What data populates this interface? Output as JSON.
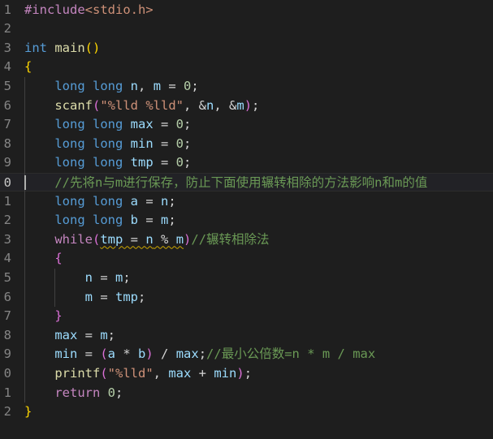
{
  "colors": {
    "background": "#1e1e1e",
    "keyword": "#569cd6",
    "control": "#c586c0",
    "function": "#dcdcaa",
    "variable": "#9cdcfe",
    "string": "#ce9178",
    "number": "#b5cea8",
    "comment": "#6a9955",
    "plain": "#d4d4d4",
    "bracket_gold": "#ffd700",
    "bracket_purple": "#da70d6",
    "line_number": "#858585",
    "warning_squiggle": "#cca700"
  },
  "editor": {
    "active_line": 9,
    "lines": [
      {
        "num": "1",
        "tokens": [
          {
            "t": "#include",
            "c": "control"
          },
          {
            "t": "<stdio.h>",
            "c": "string"
          }
        ]
      },
      {
        "num": "2",
        "tokens": []
      },
      {
        "num": "3",
        "tokens": [
          {
            "t": "int",
            "c": "keyword"
          },
          {
            "t": " ",
            "c": "plain"
          },
          {
            "t": "main",
            "c": "function"
          },
          {
            "t": "()",
            "c": "bracket_gold"
          }
        ]
      },
      {
        "num": "4",
        "tokens": [
          {
            "t": "{",
            "c": "bracket_gold"
          }
        ]
      },
      {
        "num": "5",
        "tokens": [
          {
            "t": "    ",
            "c": "plain"
          },
          {
            "t": "long",
            "c": "keyword"
          },
          {
            "t": " ",
            "c": "plain"
          },
          {
            "t": "long",
            "c": "keyword"
          },
          {
            "t": " ",
            "c": "plain"
          },
          {
            "t": "n",
            "c": "variable"
          },
          {
            "t": ", ",
            "c": "plain"
          },
          {
            "t": "m",
            "c": "variable"
          },
          {
            "t": " = ",
            "c": "plain"
          },
          {
            "t": "0",
            "c": "number"
          },
          {
            "t": ";",
            "c": "plain"
          }
        ]
      },
      {
        "num": "6",
        "tokens": [
          {
            "t": "    ",
            "c": "plain"
          },
          {
            "t": "scanf",
            "c": "function"
          },
          {
            "t": "(",
            "c": "bracket_purple"
          },
          {
            "t": "\"%lld %lld\"",
            "c": "string"
          },
          {
            "t": ", &",
            "c": "plain"
          },
          {
            "t": "n",
            "c": "variable"
          },
          {
            "t": ", &",
            "c": "plain"
          },
          {
            "t": "m",
            "c": "variable"
          },
          {
            "t": ")",
            "c": "bracket_purple"
          },
          {
            "t": ";",
            "c": "plain"
          }
        ]
      },
      {
        "num": "7",
        "tokens": [
          {
            "t": "    ",
            "c": "plain"
          },
          {
            "t": "long",
            "c": "keyword"
          },
          {
            "t": " ",
            "c": "plain"
          },
          {
            "t": "long",
            "c": "keyword"
          },
          {
            "t": " ",
            "c": "plain"
          },
          {
            "t": "max",
            "c": "variable"
          },
          {
            "t": " = ",
            "c": "plain"
          },
          {
            "t": "0",
            "c": "number"
          },
          {
            "t": ";",
            "c": "plain"
          }
        ]
      },
      {
        "num": "8",
        "tokens": [
          {
            "t": "    ",
            "c": "plain"
          },
          {
            "t": "long",
            "c": "keyword"
          },
          {
            "t": " ",
            "c": "plain"
          },
          {
            "t": "long",
            "c": "keyword"
          },
          {
            "t": " ",
            "c": "plain"
          },
          {
            "t": "min",
            "c": "variable"
          },
          {
            "t": " = ",
            "c": "plain"
          },
          {
            "t": "0",
            "c": "number"
          },
          {
            "t": ";",
            "c": "plain"
          }
        ]
      },
      {
        "num": "9",
        "tokens": [
          {
            "t": "    ",
            "c": "plain"
          },
          {
            "t": "long",
            "c": "keyword"
          },
          {
            "t": " ",
            "c": "plain"
          },
          {
            "t": "long",
            "c": "keyword"
          },
          {
            "t": " ",
            "c": "plain"
          },
          {
            "t": "tmp",
            "c": "variable"
          },
          {
            "t": " = ",
            "c": "plain"
          },
          {
            "t": "0",
            "c": "number"
          },
          {
            "t": ";",
            "c": "plain"
          }
        ]
      },
      {
        "num": "0",
        "tokens": [
          {
            "t": "    ",
            "c": "plain"
          },
          {
            "t": "//先将n与m进行保存，防止下面使用辗转相除的方法影响n和m的值",
            "c": "comment"
          }
        ]
      },
      {
        "num": "1",
        "tokens": [
          {
            "t": "    ",
            "c": "plain"
          },
          {
            "t": "long",
            "c": "keyword"
          },
          {
            "t": " ",
            "c": "plain"
          },
          {
            "t": "long",
            "c": "keyword"
          },
          {
            "t": " ",
            "c": "plain"
          },
          {
            "t": "a",
            "c": "variable"
          },
          {
            "t": " = ",
            "c": "plain"
          },
          {
            "t": "n",
            "c": "variable"
          },
          {
            "t": ";",
            "c": "plain"
          }
        ]
      },
      {
        "num": "2",
        "tokens": [
          {
            "t": "    ",
            "c": "plain"
          },
          {
            "t": "long",
            "c": "keyword"
          },
          {
            "t": " ",
            "c": "plain"
          },
          {
            "t": "long",
            "c": "keyword"
          },
          {
            "t": " ",
            "c": "plain"
          },
          {
            "t": "b",
            "c": "variable"
          },
          {
            "t": " = ",
            "c": "plain"
          },
          {
            "t": "m",
            "c": "variable"
          },
          {
            "t": ";",
            "c": "plain"
          }
        ]
      },
      {
        "num": "3",
        "tokens": [
          {
            "t": "    ",
            "c": "plain"
          },
          {
            "t": "while",
            "c": "control"
          },
          {
            "t": "(",
            "c": "bracket_purple"
          },
          {
            "t": "tmp",
            "c": "variable",
            "sq": true
          },
          {
            "t": " = ",
            "c": "plain",
            "sq": true
          },
          {
            "t": "n",
            "c": "variable",
            "sq": true
          },
          {
            "t": " % ",
            "c": "plain",
            "sq": true
          },
          {
            "t": "m",
            "c": "variable",
            "sq": true
          },
          {
            "t": ")",
            "c": "bracket_purple"
          },
          {
            "t": "//辗转相除法",
            "c": "comment"
          }
        ]
      },
      {
        "num": "4",
        "tokens": [
          {
            "t": "    ",
            "c": "plain"
          },
          {
            "t": "{",
            "c": "bracket_purple"
          }
        ]
      },
      {
        "num": "5",
        "tokens": [
          {
            "t": "        ",
            "c": "plain"
          },
          {
            "t": "n",
            "c": "variable"
          },
          {
            "t": " = ",
            "c": "plain"
          },
          {
            "t": "m",
            "c": "variable"
          },
          {
            "t": ";",
            "c": "plain"
          }
        ]
      },
      {
        "num": "6",
        "tokens": [
          {
            "t": "        ",
            "c": "plain"
          },
          {
            "t": "m",
            "c": "variable"
          },
          {
            "t": " = ",
            "c": "plain"
          },
          {
            "t": "tmp",
            "c": "variable"
          },
          {
            "t": ";",
            "c": "plain"
          }
        ]
      },
      {
        "num": "7",
        "tokens": [
          {
            "t": "    ",
            "c": "plain"
          },
          {
            "t": "}",
            "c": "bracket_purple"
          }
        ]
      },
      {
        "num": "8",
        "tokens": [
          {
            "t": "    ",
            "c": "plain"
          },
          {
            "t": "max",
            "c": "variable"
          },
          {
            "t": " = ",
            "c": "plain"
          },
          {
            "t": "m",
            "c": "variable"
          },
          {
            "t": ";",
            "c": "plain"
          }
        ]
      },
      {
        "num": "9",
        "tokens": [
          {
            "t": "    ",
            "c": "plain"
          },
          {
            "t": "min",
            "c": "variable"
          },
          {
            "t": " = ",
            "c": "plain"
          },
          {
            "t": "(",
            "c": "bracket_purple"
          },
          {
            "t": "a",
            "c": "variable"
          },
          {
            "t": " * ",
            "c": "plain"
          },
          {
            "t": "b",
            "c": "variable"
          },
          {
            "t": ")",
            "c": "bracket_purple"
          },
          {
            "t": " / ",
            "c": "plain"
          },
          {
            "t": "max",
            "c": "variable"
          },
          {
            "t": ";",
            "c": "plain"
          },
          {
            "t": "//最小公倍数=n * m / max",
            "c": "comment"
          }
        ]
      },
      {
        "num": "0",
        "tokens": [
          {
            "t": "    ",
            "c": "plain"
          },
          {
            "t": "printf",
            "c": "function"
          },
          {
            "t": "(",
            "c": "bracket_purple"
          },
          {
            "t": "\"%lld\"",
            "c": "string"
          },
          {
            "t": ", ",
            "c": "plain"
          },
          {
            "t": "max",
            "c": "variable"
          },
          {
            "t": " + ",
            "c": "plain"
          },
          {
            "t": "min",
            "c": "variable"
          },
          {
            "t": ")",
            "c": "bracket_purple"
          },
          {
            "t": ";",
            "c": "plain"
          }
        ]
      },
      {
        "num": "1",
        "tokens": [
          {
            "t": "    ",
            "c": "plain"
          },
          {
            "t": "return",
            "c": "control"
          },
          {
            "t": " ",
            "c": "plain"
          },
          {
            "t": "0",
            "c": "number"
          },
          {
            "t": ";",
            "c": "plain"
          }
        ]
      },
      {
        "num": "2",
        "tokens": [
          {
            "t": "}",
            "c": "bracket_gold"
          }
        ]
      }
    ]
  }
}
